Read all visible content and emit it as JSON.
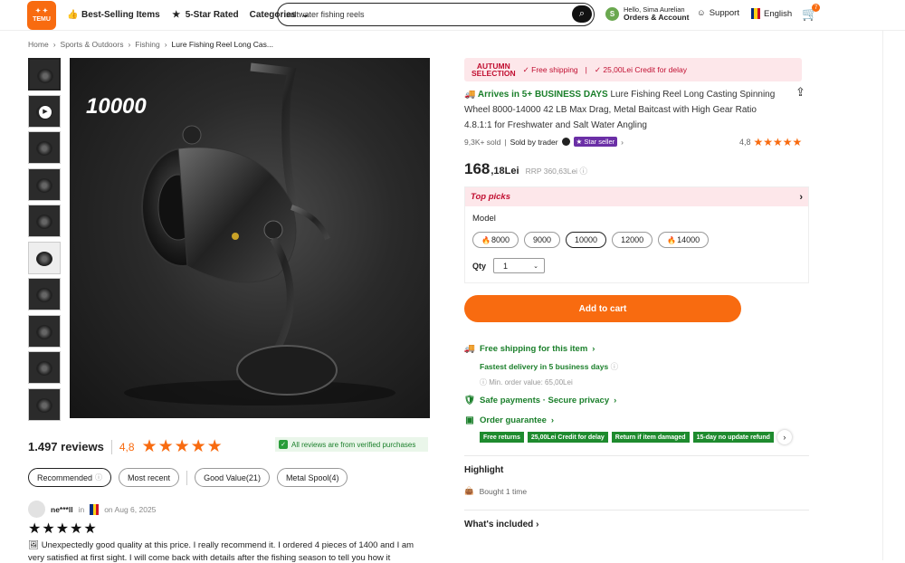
{
  "header": {
    "logo_text": "TEMU",
    "nav": [
      {
        "label": "Best-Selling Items",
        "icon": "thumbs-up-icon"
      },
      {
        "label": "5-Star Rated",
        "icon": "star-badge-icon"
      },
      {
        "label": "Categories",
        "icon": "chevron-down-icon"
      }
    ],
    "search_value": "saltwater fishing reels",
    "account_initial": "S",
    "account_greeting": "Hello, Sima Aurelian",
    "account_link": "Orders & Account",
    "support_label": "Support",
    "language_label": "English",
    "cart_count": "7"
  },
  "breadcrumb": [
    "Home",
    "Sports & Outdoors",
    "Fishing",
    "Lure Fishing Reel Long Cas..."
  ],
  "gallery": {
    "main_label": "10000",
    "thumbnail_count": 10
  },
  "reviews": {
    "count": "1.497 reviews",
    "rating": "4,8",
    "stars": "★★★★★",
    "verified_text": "All reviews are from verified purchases",
    "filters": [
      "Recommended",
      "Most recent",
      "Good Value(21)",
      "Metal Spool(4)"
    ],
    "first": {
      "name": "ne***ll",
      "in_text": "in",
      "date": "on Aug 6, 2025",
      "stars": "★★★★★",
      "text": "Unexpectedly good quality at this price. I really recommend it. I ordered 4 pieces of 1400 and I am very satisfied at first sight. I will come back with details after the fishing season to tell you how it behaves."
    }
  },
  "promo": {
    "badge_line1": "AUTUMN",
    "badge_line2": "SELECTION",
    "free_shipping": "Free shipping",
    "credit": "25,00Lei Credit for delay"
  },
  "product": {
    "arrival": "Arrives in 5+ BUSINESS DAYS",
    "title": "Lure Fishing Reel Long Casting Spinning Wheel 8000-14000 42 LB Max Drag, Metal Baitcast with High Gear Ratio 4.8.1:1 for Freshwater and Salt Water Angling",
    "sold": "9,3K+ sold",
    "sold_by": "Sold by trader",
    "star_seller": "Star seller",
    "rating": "4,8",
    "stars": "★★★★★",
    "price_main": "168",
    "price_cents": ",18Lei",
    "rrp": "RRP 360,63Lei"
  },
  "options": {
    "top_picks": "Top picks",
    "model_label": "Model",
    "models": [
      {
        "label": "8000",
        "hot": true
      },
      {
        "label": "9000",
        "hot": false
      },
      {
        "label": "10000",
        "hot": false,
        "selected": true
      },
      {
        "label": "12000",
        "hot": false
      },
      {
        "label": "14000",
        "hot": true
      }
    ],
    "qty_label": "Qty",
    "qty_value": "1"
  },
  "actions": {
    "add_to_cart": "Add to cart"
  },
  "services": {
    "free_shipping": "Free shipping for this item",
    "fastest_delivery": "Fastest delivery in 5 business days",
    "min_order": "Min. order value: 65,00Lei",
    "safe_payments": "Safe payments · Secure privacy",
    "order_guarantee": "Order guarantee",
    "guarantee_tags": [
      "Free returns",
      "25,00Lei Credit for delay",
      "Return if item damaged",
      "15-day no update refund"
    ]
  },
  "highlight": {
    "title": "Highlight",
    "bought": "Bought 1 time"
  },
  "whats_included": "What's included",
  "colors": {
    "brand_orange": "#f86b10",
    "success_green": "#1a7f2a",
    "promo_red": "#c10f31",
    "star_seller_purple": "#6b2fa6"
  }
}
